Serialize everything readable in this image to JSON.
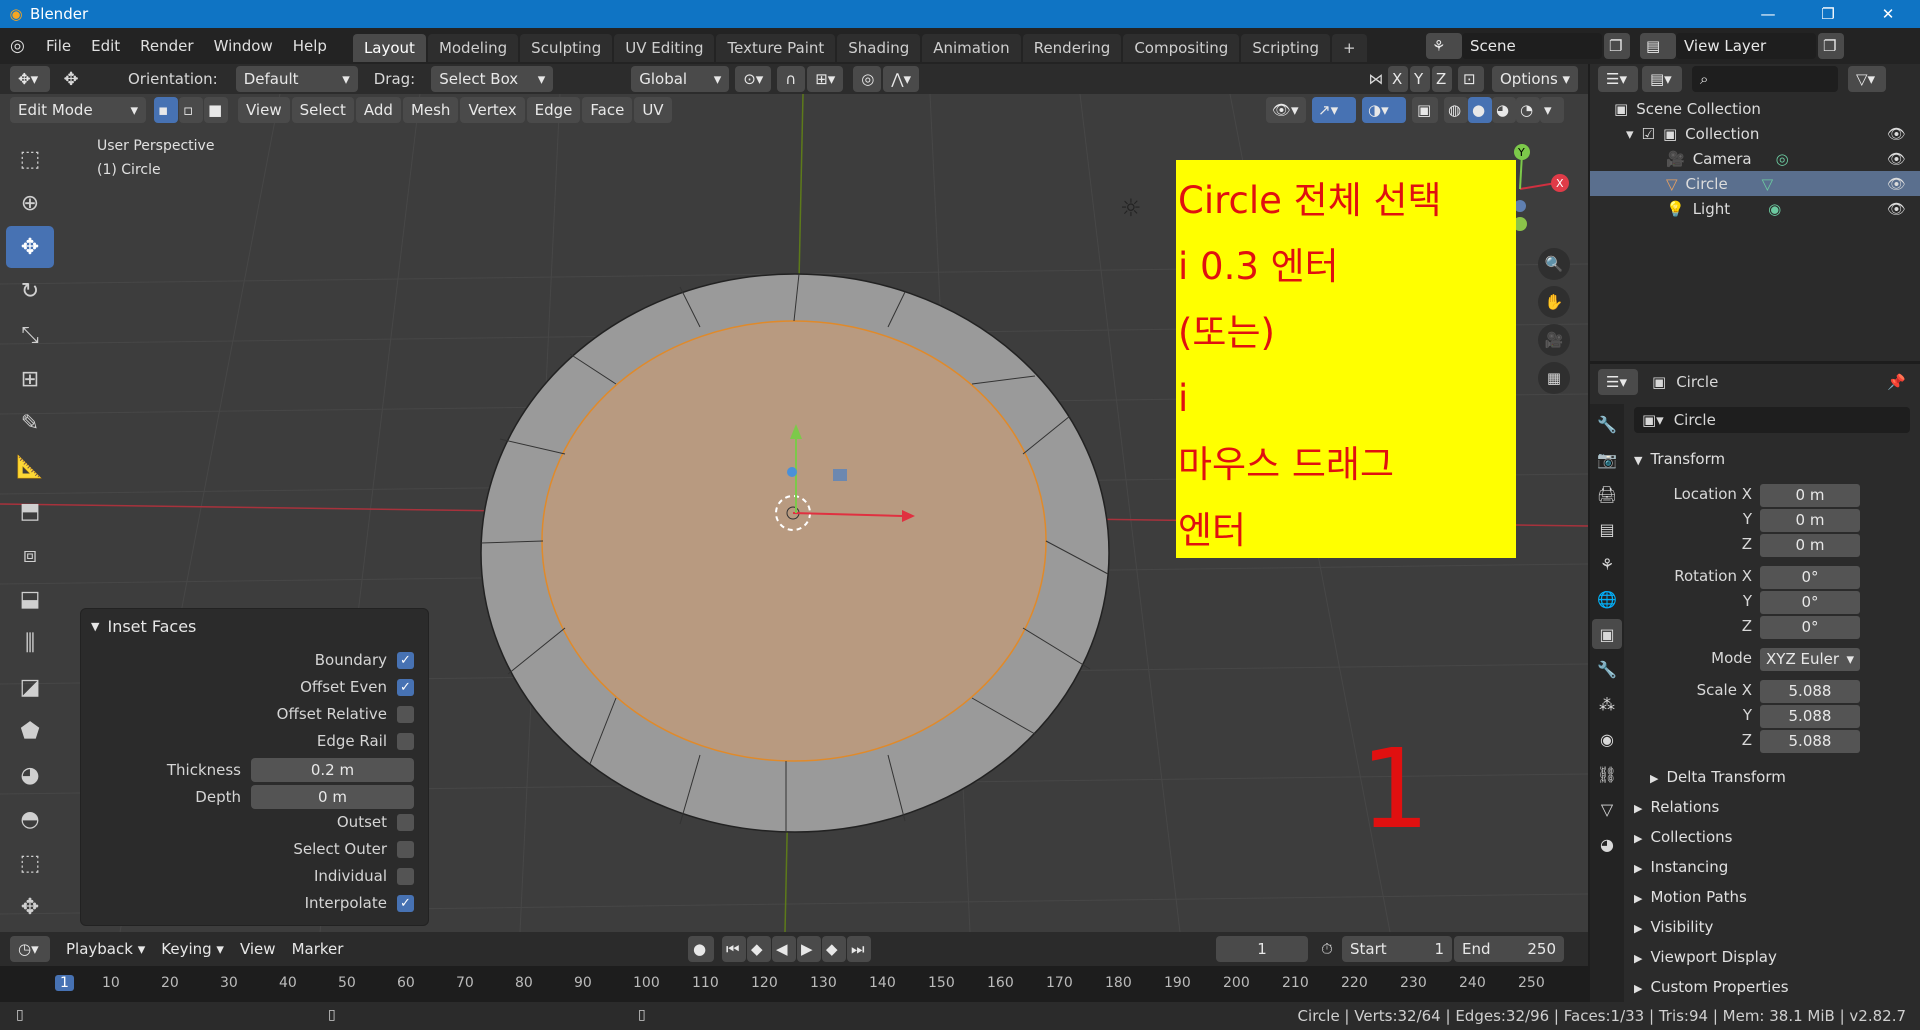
{
  "window": {
    "title": "Blender",
    "min": "—",
    "max": "❐",
    "close": "✕"
  },
  "menu": [
    "File",
    "Edit",
    "Render",
    "Window",
    "Help"
  ],
  "workspaces": [
    "Layout",
    "Modeling",
    "Sculpting",
    "UV Editing",
    "Texture Paint",
    "Shading",
    "Animation",
    "Rendering",
    "Compositing",
    "Scripting",
    "+"
  ],
  "scene": "Scene",
  "view_layer": "View Layer",
  "tool_header": {
    "orientation_label": "Orientation:",
    "orientation_value": "Default",
    "drag_label": "Drag:",
    "drag_value": "Select Box",
    "transform_space": "Global",
    "axes": [
      "X",
      "Y",
      "Z"
    ],
    "options": "Options"
  },
  "view_header": {
    "mode": "Edit Mode",
    "menus": [
      "View",
      "Select",
      "Add",
      "Mesh",
      "Vertex",
      "Edge",
      "Face",
      "UV"
    ]
  },
  "viewport": {
    "perspective": "User Perspective",
    "object": "(1) Circle",
    "gizmo": {
      "x": "X",
      "y": "Y",
      "z": "Z"
    },
    "annotation_number": "1"
  },
  "note": {
    "lines": [
      "Circle 전체 선택",
      "i 0.3 엔터",
      "(또는)",
      "i",
      "마우스 드래그",
      "엔터"
    ]
  },
  "inset_panel": {
    "title": "Inset Faces",
    "boundary": {
      "label": "Boundary",
      "checked": true
    },
    "offset_even": {
      "label": "Offset Even",
      "checked": true
    },
    "offset_relative": {
      "label": "Offset Relative",
      "checked": false
    },
    "edge_rail": {
      "label": "Edge Rail",
      "checked": false
    },
    "thickness": {
      "label": "Thickness",
      "value": "0.2 m"
    },
    "depth": {
      "label": "Depth",
      "value": "0 m"
    },
    "outset": {
      "label": "Outset",
      "checked": false
    },
    "select_outer": {
      "label": "Select Outer",
      "checked": false
    },
    "individual": {
      "label": "Individual",
      "checked": false
    },
    "interpolate": {
      "label": "Interpolate",
      "checked": true
    },
    "check_glyph": "✓"
  },
  "outliner": {
    "scene_collection": "Scene Collection",
    "collection": "Collection",
    "items": [
      "Camera",
      "Circle",
      "Light"
    ]
  },
  "properties": {
    "header_object": "Circle",
    "name_field": "Circle",
    "transform_title": "Transform",
    "location": {
      "label": "Location X",
      "x": "0 m",
      "y": "0 m",
      "z": "0 m"
    },
    "rotation": {
      "label": "Rotation X",
      "x": "0°",
      "y": "0°",
      "z": "0°"
    },
    "mode": {
      "label": "Mode",
      "value": "XYZ Euler"
    },
    "scale": {
      "label": "Scale X",
      "x": "5.088",
      "y": "5.088",
      "z": "5.088"
    },
    "axis_y": "Y",
    "axis_z": "Z",
    "delta_transform": "Delta Transform",
    "panels": [
      "Relations",
      "Collections",
      "Instancing",
      "Motion Paths",
      "Visibility",
      "Viewport Display",
      "Custom Properties"
    ]
  },
  "timeline": {
    "playback": "Playback",
    "keying": "Keying",
    "view": "View",
    "marker": "Marker",
    "current_frame": "1",
    "start_label": "Start",
    "start": "1",
    "end_label": "End",
    "end": "250",
    "ruler": [
      "1",
      "10",
      "20",
      "30",
      "40",
      "50",
      "60",
      "70",
      "80",
      "90",
      "100",
      "110",
      "120",
      "130",
      "140",
      "150",
      "160",
      "170",
      "180",
      "190",
      "200",
      "210",
      "220",
      "230",
      "240",
      "250"
    ]
  },
  "statusbar": {
    "text": "Circle | Verts:32/64 | Edges:32/96 | Faces:1/33 | Tris:94 | Mem: 38.1 MiB | v2.82.7"
  },
  "colors": {
    "accent": "#4772b3",
    "title_bar": "#0f74c4",
    "note_bg": "#ffff00",
    "note_text": "#e01010",
    "selected_face": "#b89a80",
    "x_axis": "#ff3b4e",
    "y_axis": "#8bc34a"
  }
}
